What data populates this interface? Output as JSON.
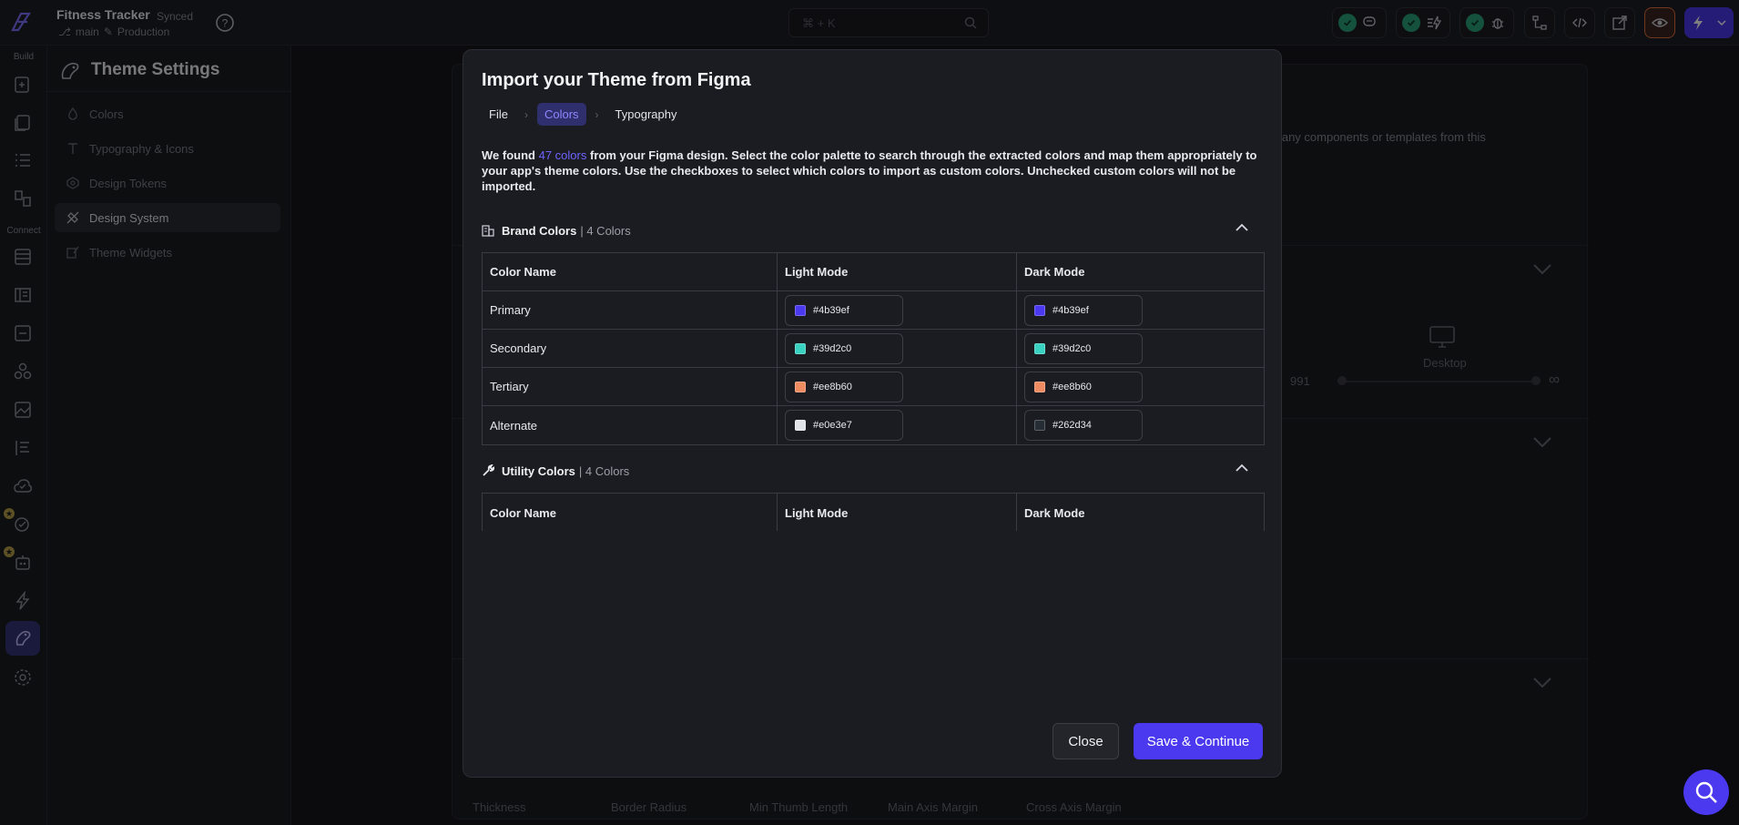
{
  "app": {
    "project_name": "Fitness Tracker",
    "sync_status": "Synced",
    "branch": "main",
    "environment": "Production",
    "search_placeholder": "⌘ + K"
  },
  "rail": {
    "build_label": "Build",
    "connect_label": "Connect"
  },
  "side_panel": {
    "title": "Theme Settings",
    "items": [
      {
        "label": "Colors",
        "icon": "droplet-icon"
      },
      {
        "label": "Typography & Icons",
        "icon": "typography-icon"
      },
      {
        "label": "Design Tokens",
        "icon": "token-icon"
      },
      {
        "label": "Design System",
        "icon": "design-system-icon",
        "selected": true
      },
      {
        "label": "Theme Widgets",
        "icon": "widget-brush-icon"
      }
    ]
  },
  "background": {
    "partial_text": "o any components or templates from this",
    "breakpoint_value": "991",
    "desktop_label": "Desktop",
    "infinity": "∞",
    "scrollbar_labels": [
      "Thickness",
      "Border Radius",
      "Min Thumb Length",
      "Main Axis Margin",
      "Cross Axis Margin"
    ]
  },
  "modal": {
    "title": "Import your Theme from Figma",
    "breadcrumbs": [
      "File",
      "Colors",
      "Typography"
    ],
    "active_crumb": "Colors",
    "description_prefix": "We found",
    "color_count_link": "47 colors",
    "description_suffix": "from your Figma design. Select the color palette to search through the extracted colors and map them appropriately to your app's theme colors. Use the checkboxes to select which colors to import as custom colors. Unchecked custom colors will not be imported.",
    "groups": [
      {
        "name": "Brand Colors",
        "count": "| 4 Colors",
        "icon": "building-icon",
        "headers": [
          "Color Name",
          "Light Mode",
          "Dark Mode"
        ],
        "rows": [
          {
            "name": "Primary",
            "light": "#4b39ef",
            "dark": "#4b39ef"
          },
          {
            "name": "Secondary",
            "light": "#39d2c0",
            "dark": "#39d2c0"
          },
          {
            "name": "Tertiary",
            "light": "#ee8b60",
            "dark": "#ee8b60"
          },
          {
            "name": "Alternate",
            "light": "#e0e3e7",
            "dark": "#262d34"
          }
        ]
      },
      {
        "name": "Utility Colors",
        "count": "| 4 Colors",
        "icon": "wrench-icon",
        "headers": [
          "Color Name",
          "Light Mode",
          "Dark Mode"
        ]
      }
    ],
    "close_label": "Close",
    "save_label": "Save & Continue"
  },
  "colors": {
    "accent": "#4b39ef",
    "accent_link": "#6f64ff",
    "success": "#2aa57a"
  }
}
